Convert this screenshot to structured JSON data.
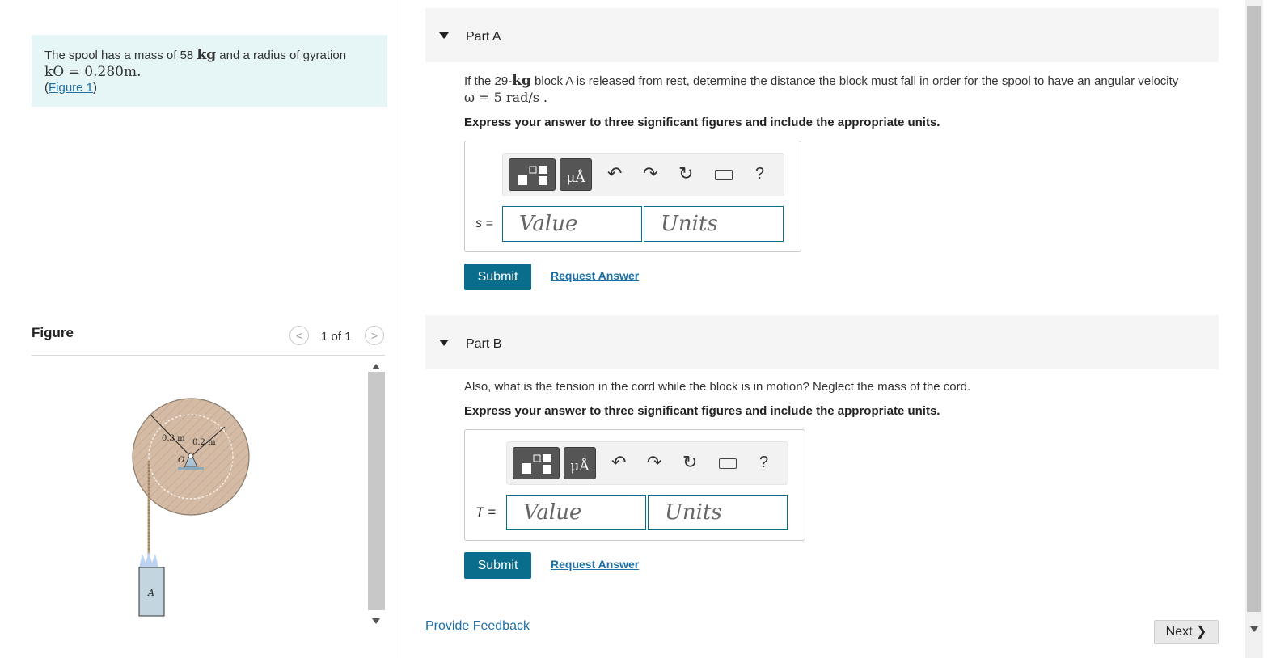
{
  "problem": {
    "text_pre": "The spool has a mass of 58 ",
    "kg": "kg",
    "text_mid": " and a radius of gyration",
    "kO": "kO = 0.280m.",
    "figure_link": "Figure 1"
  },
  "figure": {
    "title": "Figure",
    "counter": "1 of 1",
    "prev_glyph": "<",
    "next_glyph": ">",
    "labels": {
      "r_outer": "0.3 m",
      "r_inner": "0.2 m",
      "center": "O",
      "block": "A"
    }
  },
  "parts": [
    {
      "title": "Part A",
      "question_pre": "If the 29-",
      "question_kg": "kg",
      "question_post": " block A is released from rest, determine the distance the block must fall in order for the spool to have an angular velocity",
      "question_line2": "ω = 5 rad/s .",
      "instruction": "Express your answer to three significant figures and include the appropriate units.",
      "variable": "s =",
      "value_placeholder": "Value",
      "units_placeholder": "Units",
      "submit": "Submit",
      "request": "Request Answer"
    },
    {
      "title": "Part B",
      "question": "Also, what is the tension in the cord while the block is in motion? Neglect the mass of the cord.",
      "instruction": "Express your answer to three significant figures and include the appropriate units.",
      "variable": "T =",
      "value_placeholder": "Value",
      "units_placeholder": "Units",
      "submit": "Submit",
      "request": "Request Answer"
    }
  ],
  "toolbar": {
    "units_button": "μÅ",
    "undo": "↶",
    "redo": "↷",
    "reset": "↻",
    "help": "?",
    "icons": [
      "templates-icon",
      "units-icon",
      "undo-icon",
      "redo-icon",
      "reset-icon",
      "keyboard-icon",
      "help-icon"
    ]
  },
  "footer": {
    "feedback": "Provide Feedback",
    "next": "Next ❯"
  },
  "colors": {
    "accent": "#0a6d8c",
    "link": "#1d6fa5",
    "problem_bg": "#e6f5f5"
  }
}
